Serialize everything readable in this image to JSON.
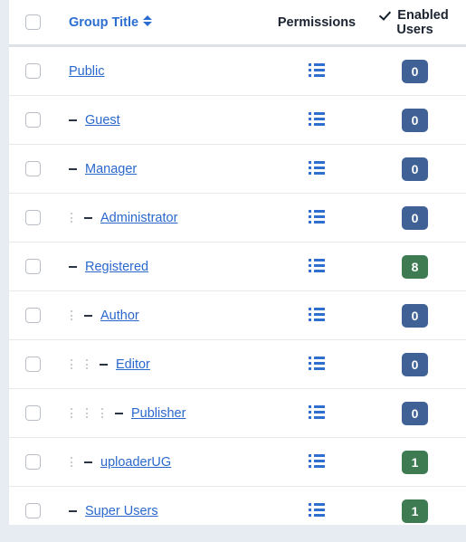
{
  "colors": {
    "link": "#2a68cd",
    "header_link": "#2c6ed0",
    "badge_zero": "#3f6196",
    "badge_count": "#3e7a52",
    "page_bg": "#e7ecf3",
    "row_border": "#e6e8ec",
    "header_border": "#dde2e9"
  },
  "header": {
    "select_all_label": "",
    "group_title": "Group Title",
    "sort_icon": "sort-updown-icon",
    "permissions": "Permissions",
    "enabled_users": "Enabled Users",
    "enabled_users_check_icon": "check-icon"
  },
  "rows": [
    {
      "title": "Public",
      "level": 0,
      "dots": 0,
      "dash": false,
      "permissions_icon": "list-icon",
      "users": "0",
      "users_state": "zero"
    },
    {
      "title": "Guest",
      "level": 1,
      "dots": 0,
      "dash": true,
      "permissions_icon": "list-icon",
      "users": "0",
      "users_state": "zero"
    },
    {
      "title": "Manager",
      "level": 1,
      "dots": 0,
      "dash": true,
      "permissions_icon": "list-icon",
      "users": "0",
      "users_state": "zero"
    },
    {
      "title": "Administrator",
      "level": 2,
      "dots": 1,
      "dash": true,
      "permissions_icon": "list-icon",
      "users": "0",
      "users_state": "zero"
    },
    {
      "title": "Registered",
      "level": 1,
      "dots": 0,
      "dash": true,
      "permissions_icon": "list-icon",
      "users": "8",
      "users_state": "count"
    },
    {
      "title": "Author",
      "level": 2,
      "dots": 1,
      "dash": true,
      "permissions_icon": "list-icon",
      "users": "0",
      "users_state": "zero"
    },
    {
      "title": "Editor",
      "level": 3,
      "dots": 2,
      "dash": true,
      "permissions_icon": "list-icon",
      "users": "0",
      "users_state": "zero"
    },
    {
      "title": "Publisher",
      "level": 4,
      "dots": 3,
      "dash": true,
      "permissions_icon": "list-icon",
      "users": "0",
      "users_state": "zero"
    },
    {
      "title": "uploaderUG",
      "level": 2,
      "dots": 1,
      "dash": true,
      "permissions_icon": "list-icon",
      "users": "1",
      "users_state": "count"
    },
    {
      "title": "Super Users",
      "level": 1,
      "dots": 0,
      "dash": true,
      "permissions_icon": "list-icon",
      "users": "1",
      "users_state": "count"
    }
  ]
}
